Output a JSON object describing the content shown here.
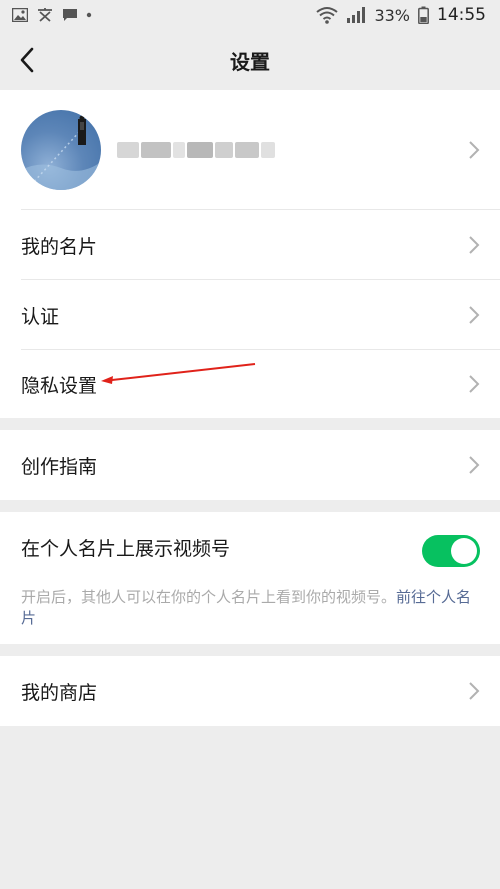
{
  "status_bar": {
    "battery_percent": "33%",
    "time": "14:55"
  },
  "nav": {
    "title": "设置"
  },
  "menu": {
    "my_card": "我的名片",
    "verification": "认证",
    "privacy": "隐私设置",
    "creation_guide": "创作指南",
    "show_on_card": "在个人名片上展示视频号",
    "show_on_card_desc": "开启后，其他人可以在你的个人名片上看到你的视频号。",
    "show_on_card_link": "前往个人名片",
    "show_on_card_enabled": true,
    "my_store": "我的商店"
  },
  "colors": {
    "accent_green": "#07c160",
    "link_blue": "#576b95",
    "annotation_red": "#e0221a"
  }
}
